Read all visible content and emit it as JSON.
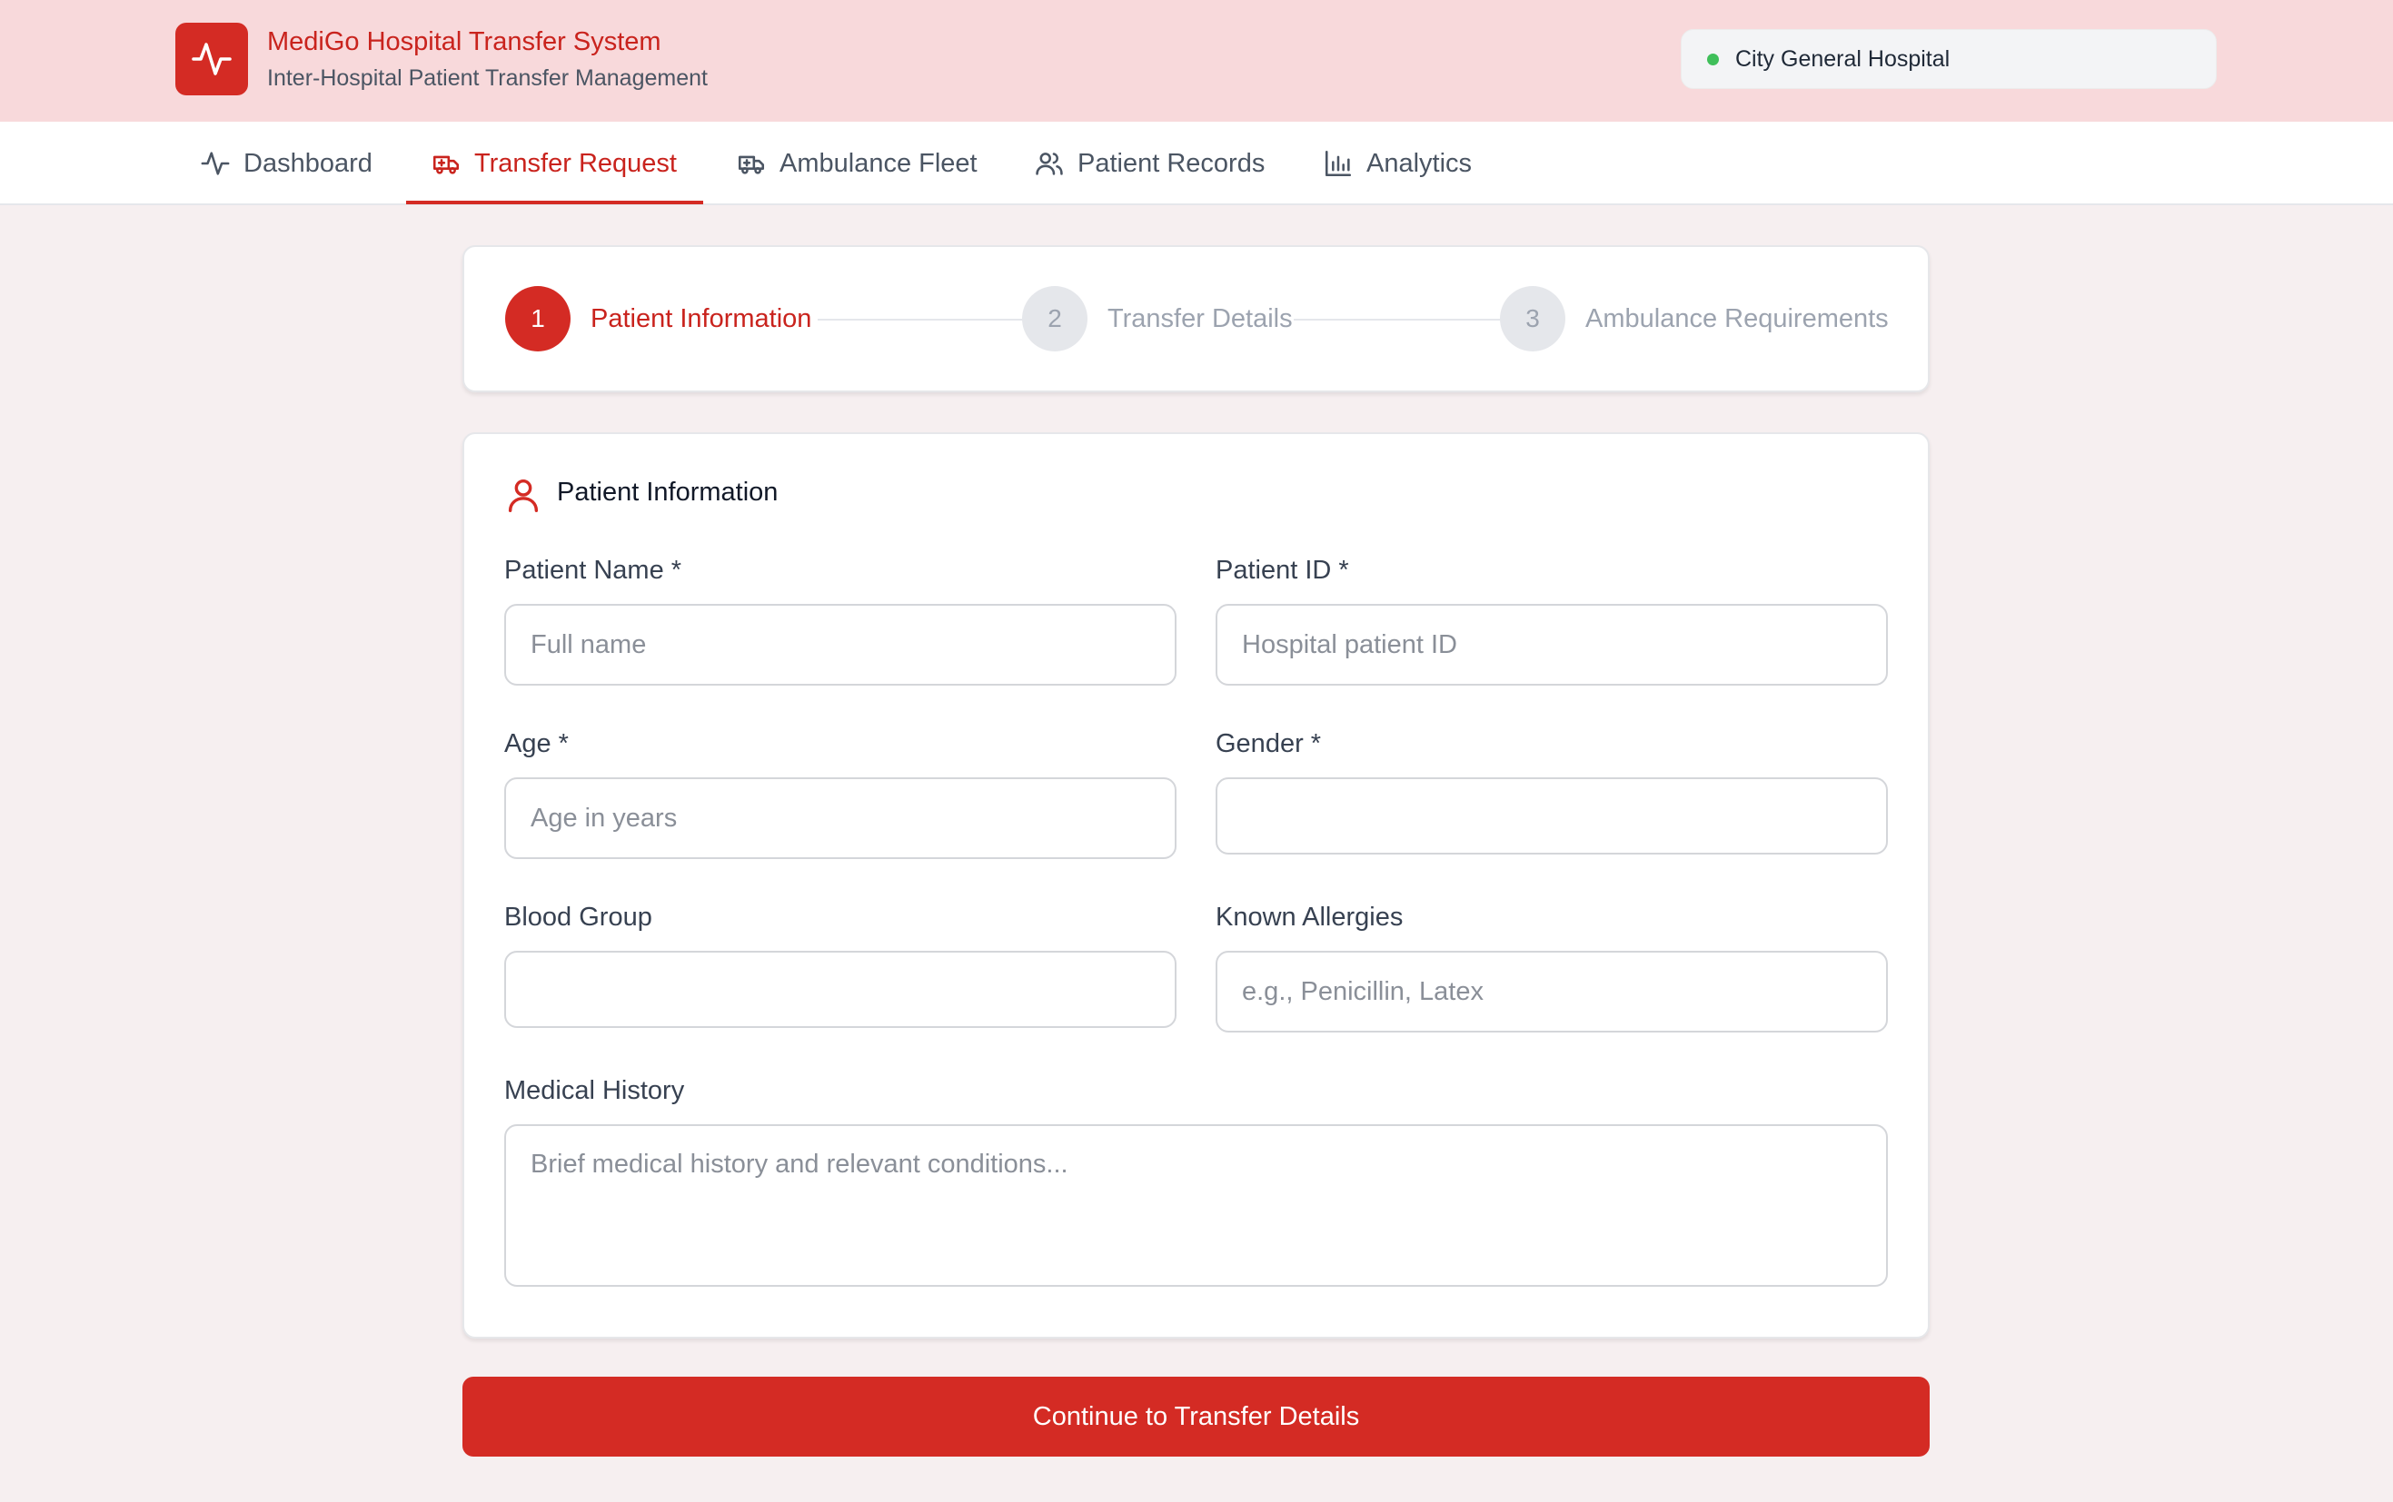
{
  "header": {
    "title": "MediGo Hospital Transfer System",
    "subtitle": "Inter-Hospital Patient Transfer Management",
    "hospital": "City General Hospital",
    "status_color": "#3fbf5a",
    "brand_color": "#d42b24"
  },
  "nav": {
    "tabs": [
      {
        "label": "Dashboard",
        "icon": "activity-icon",
        "active": false
      },
      {
        "label": "Transfer Request",
        "icon": "ambulance-icon",
        "active": true
      },
      {
        "label": "Ambulance Fleet",
        "icon": "truck-icon",
        "active": false
      },
      {
        "label": "Patient Records",
        "icon": "users-icon",
        "active": false
      },
      {
        "label": "Analytics",
        "icon": "bar-chart-icon",
        "active": false
      }
    ]
  },
  "stepper": {
    "steps": [
      {
        "number": "1",
        "label": "Patient Information",
        "active": true
      },
      {
        "number": "2",
        "label": "Transfer Details",
        "active": false
      },
      {
        "number": "3",
        "label": "Ambulance Requirements",
        "active": false
      }
    ]
  },
  "form": {
    "section_title": "Patient Information",
    "section_icon": "user-icon",
    "fields": {
      "patient_name": {
        "label": "Patient Name *",
        "placeholder": "Full name",
        "value": ""
      },
      "patient_id": {
        "label": "Patient ID *",
        "placeholder": "Hospital patient ID",
        "value": ""
      },
      "age": {
        "label": "Age *",
        "placeholder": "Age in years",
        "value": ""
      },
      "gender": {
        "label": "Gender *",
        "value": ""
      },
      "blood_group": {
        "label": "Blood Group",
        "value": ""
      },
      "allergies": {
        "label": "Known Allergies",
        "placeholder": "e.g., Penicillin, Latex",
        "value": ""
      },
      "medical_history": {
        "label": "Medical History",
        "placeholder": "Brief medical history and relevant conditions...",
        "value": ""
      }
    }
  },
  "actions": {
    "continue_label": "Continue to Transfer Details"
  }
}
